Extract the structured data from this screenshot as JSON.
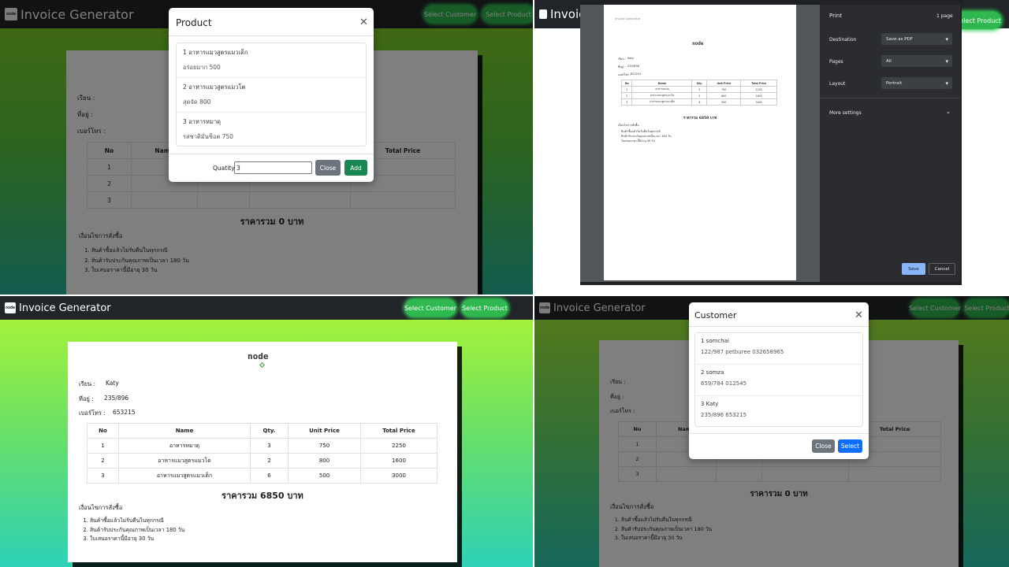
{
  "app": {
    "title": "Invoice Generator",
    "logo_icon": "node-logo",
    "logo_text": "node"
  },
  "nav": {
    "select_customer": "Select Customer",
    "select_product": "Select Product"
  },
  "invoice_labels": {
    "to": "เรียน :",
    "address": "ที่อยู่ :",
    "phone": "เบอร์โทร :",
    "table_headers": [
      "No",
      "Name",
      "Qty.",
      "Unit Price",
      "Total Price"
    ],
    "terms_heading": "เงื่อนไขการสั่งซื้อ",
    "terms": [
      "สินค้าซื้อแล้วไม่รับคืนในทุกกรณี",
      "สินค้ารับประกันคุณภาพเป็นเวลา 180 วัน",
      "ใบเสนอราคานี้มีอายุ 30 วัน"
    ]
  },
  "empty_invoice": {
    "rows": [
      "1",
      "2",
      "3"
    ],
    "total": "ราคารวม 0 บาท"
  },
  "filled_invoice": {
    "customer_name": "Katy",
    "customer_address": "235/896",
    "customer_phone": "653215",
    "rows": [
      {
        "no": "1",
        "name": "อาหารหมาดุ",
        "qty": "3",
        "unit": "750",
        "total": "2250"
      },
      {
        "no": "2",
        "name": "อาหารแมวสูตรแมวโต",
        "qty": "2",
        "unit": "800",
        "total": "1600"
      },
      {
        "no": "3",
        "name": "อาหารแมวสูตรแมวเด็ก",
        "qty": "6",
        "unit": "500",
        "total": "3000"
      }
    ],
    "total": "ราคารวม 6850 บาท"
  },
  "product_modal": {
    "title": "Product",
    "items": [
      {
        "line1": "1 อาหารแมวสูตรแมวเด็ก",
        "line2": "อร่อยมาก 500"
      },
      {
        "line1": "2 อาหารแมวสูตรแมวโต",
        "line2": "สุดจัด 800"
      },
      {
        "line1": "3 อาหารหมาดุ",
        "line2": "รสชาติมั่นช็อต 750"
      }
    ],
    "quantity_label": "Quatity",
    "quantity_value": "3",
    "close": "Close",
    "add": "Add"
  },
  "customer_modal": {
    "title": "Customer",
    "items": [
      {
        "line1": "1 somchai",
        "line2": "122/987 petburee 032658965"
      },
      {
        "line1": "2 somza",
        "line2": "659/784 012545"
      },
      {
        "line1": "3 Katy",
        "line2": "235/896 653215"
      }
    ],
    "close": "Close",
    "select": "Select"
  },
  "print_dialog": {
    "title": "Print",
    "pages_count": "1 page",
    "destination_label": "Destination",
    "destination_value": "Save as PDF",
    "pages_label": "Pages",
    "pages_value": "All",
    "layout_label": "Layout",
    "layout_value": "Portrait",
    "more_settings": "More settings",
    "save": "Save",
    "cancel": "Cancel",
    "preview_header": "Invoice Generator"
  }
}
